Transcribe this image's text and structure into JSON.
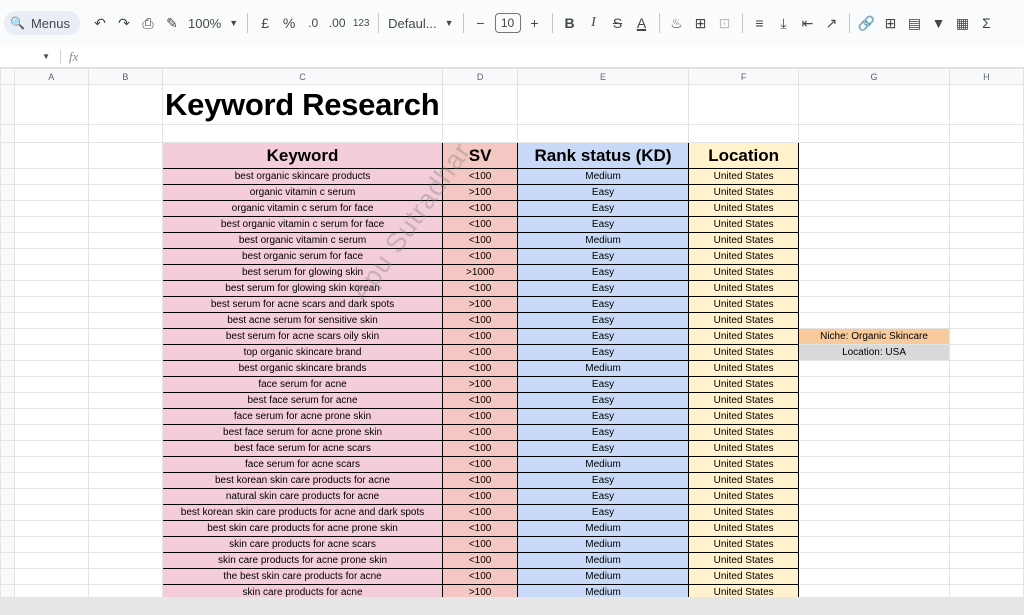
{
  "toolbar": {
    "menus_label": "Menus",
    "zoom": "100%",
    "currency": "£",
    "percent": "%",
    "dec_decrease": ".0",
    "dec_increase": ".00",
    "number_format": "123",
    "font": "Defaul...",
    "font_size": "10",
    "minus": "−",
    "plus": "+",
    "bold": "B",
    "italic": "I",
    "strike": "S",
    "text_color": "A",
    "sigma": "Σ"
  },
  "formula_bar": {
    "fx": "fx"
  },
  "columns": [
    "A",
    "B",
    "C",
    "D",
    "E",
    "F",
    "G",
    "H"
  ],
  "sheet": {
    "title": "Keyword Research",
    "headers": {
      "keyword": "Keyword",
      "sv": "SV",
      "rank": "Rank status (KD)",
      "location": "Location"
    },
    "rows": [
      {
        "keyword": "best organic skincare products",
        "sv": "<100",
        "kd": "Medium",
        "loc": "United States"
      },
      {
        "keyword": "organic vitamin c serum",
        "sv": ">100",
        "kd": "Easy",
        "loc": "United States"
      },
      {
        "keyword": "organic vitamin c serum for face",
        "sv": "<100",
        "kd": "Easy",
        "loc": "United States"
      },
      {
        "keyword": "best organic vitamin c serum for face",
        "sv": "<100",
        "kd": "Easy",
        "loc": "United States"
      },
      {
        "keyword": "best organic vitamin c serum",
        "sv": "<100",
        "kd": "Medium",
        "loc": "United States"
      },
      {
        "keyword": "best organic serum for face",
        "sv": "<100",
        "kd": "Easy",
        "loc": "United States"
      },
      {
        "keyword": "best serum for glowing skin",
        "sv": ">1000",
        "kd": "Easy",
        "loc": "United States"
      },
      {
        "keyword": "best serum for glowing skin korean",
        "sv": "<100",
        "kd": "Easy",
        "loc": "United States"
      },
      {
        "keyword": "best serum for acne scars and dark spots",
        "sv": ">100",
        "kd": "Easy",
        "loc": "United States"
      },
      {
        "keyword": "best acne serum for sensitive skin",
        "sv": "<100",
        "kd": "Easy",
        "loc": "United States"
      },
      {
        "keyword": "best serum for acne scars oily skin",
        "sv": "<100",
        "kd": "Easy",
        "loc": "United States"
      },
      {
        "keyword": "top organic skincare brand",
        "sv": "<100",
        "kd": "Easy",
        "loc": "United States"
      },
      {
        "keyword": "best organic skincare brands",
        "sv": "<100",
        "kd": "Medium",
        "loc": "United States"
      },
      {
        "keyword": "face serum for acne",
        "sv": ">100",
        "kd": "Easy",
        "loc": "United States"
      },
      {
        "keyword": "best face serum for acne",
        "sv": "<100",
        "kd": "Easy",
        "loc": "United States"
      },
      {
        "keyword": "face serum for acne prone skin",
        "sv": "<100",
        "kd": "Easy",
        "loc": "United States"
      },
      {
        "keyword": "best face serum for acne prone skin",
        "sv": "<100",
        "kd": "Easy",
        "loc": "United States"
      },
      {
        "keyword": "best face serum for acne scars",
        "sv": "<100",
        "kd": "Easy",
        "loc": "United States"
      },
      {
        "keyword": "face serum for acne scars",
        "sv": "<100",
        "kd": "Medium",
        "loc": "United States"
      },
      {
        "keyword": "best korean skin care products for acne",
        "sv": "<100",
        "kd": "Easy",
        "loc": "United States"
      },
      {
        "keyword": "natural skin care products for acne",
        "sv": "<100",
        "kd": "Easy",
        "loc": "United States"
      },
      {
        "keyword": "best korean skin care products for acne and dark spots",
        "sv": "<100",
        "kd": "Easy",
        "loc": "United States"
      },
      {
        "keyword": "best skin care products for acne prone skin",
        "sv": "<100",
        "kd": "Medium",
        "loc": "United States"
      },
      {
        "keyword": "skin care products for acne scars",
        "sv": "<100",
        "kd": "Medium",
        "loc": "United States"
      },
      {
        "keyword": "skin care products for acne prone skin",
        "sv": "<100",
        "kd": "Medium",
        "loc": "United States"
      },
      {
        "keyword": "the best skin care products for acne",
        "sv": "<100",
        "kd": "Medium",
        "loc": "United States"
      },
      {
        "keyword": "skin care products for acne",
        "sv": ">100",
        "kd": "Medium",
        "loc": "United States"
      }
    ],
    "notes": {
      "niche": "Niche: Organic Skincare",
      "location": "Location: USA"
    }
  },
  "watermark": "Apu Sutradhar",
  "colors": {
    "keyword_fill": "#f4cdd8",
    "sv_fill": "#f4c7c3",
    "rank_fill": "#c9daf8",
    "location_fill": "#fff2cc",
    "niche_fill": "#f9cb9c",
    "location_note_fill": "#d9d9d9"
  }
}
